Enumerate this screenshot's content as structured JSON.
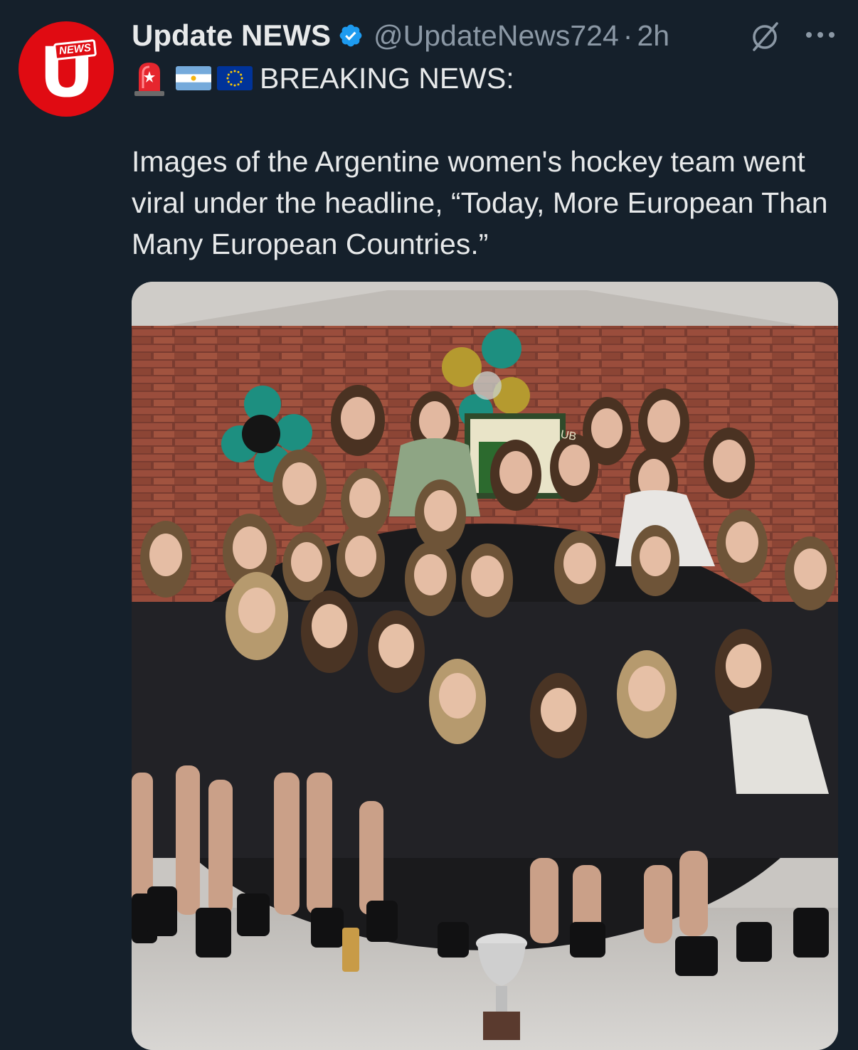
{
  "tweet": {
    "author": {
      "display_name": "Update NEWS",
      "handle": "@UpdateNews724",
      "verified": true,
      "avatar_letter": "U",
      "avatar_tag": "NEWS",
      "avatar_color": "#e00b12"
    },
    "separator": "·",
    "timestamp": "2h",
    "icons": {
      "verified": "verified-badge-icon",
      "grok": "grok-icon",
      "more": "more-options-icon",
      "siren": "police-light-emoji",
      "flag_argentina": "argentina-flag-emoji",
      "flag_eu": "eu-flag-emoji"
    },
    "headline": "BREAKING NEWS:",
    "body": "Images of the Argentine women's hockey team went viral under the headline, “Today, More European Than Many European Countries.”",
    "media": {
      "sign_text": "RUGBY CLUB"
    }
  },
  "colors": {
    "background": "#15202b",
    "primary_text": "#e7e9ea",
    "secondary_text": "#8b98a5",
    "verified_blue": "#1d9bf0"
  }
}
